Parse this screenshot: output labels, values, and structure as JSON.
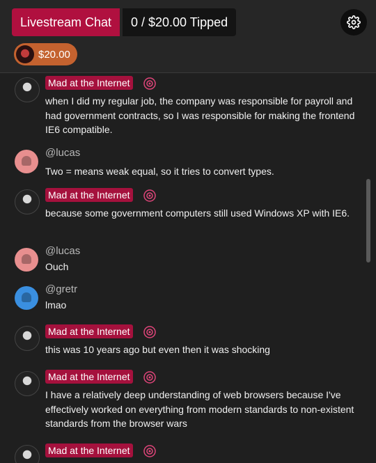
{
  "header": {
    "title": "Livestream Chat",
    "tipped": "0 / $20.00 Tipped",
    "tip_chip": "$20.00",
    "settings_icon": "gear-icon"
  },
  "colors": {
    "accent": "#b0103f",
    "username_badge": "#a5113d",
    "tip_chip": "#c4622f",
    "lucas_avatar": "#e88f8f",
    "gretr_avatar": "#3a8fe0"
  },
  "messages": [
    {
      "user": "Mad at the Internet",
      "text": "when I did my regular job, the company was responsible for payroll and had government contracts, so I was responsible for making the frontend IE6 compatible."
    },
    {
      "user": "@lucas",
      "text": "Two = means weak equal, so it tries to convert types."
    },
    {
      "user": "Mad at the Internet",
      "text": "because some government computers still used Windows XP with IE6."
    },
    {
      "user": "@lucas",
      "text": "Ouch"
    },
    {
      "user": "@gretr",
      "text": "lmao"
    },
    {
      "user": "Mad at the Internet",
      "text": "this was 10 years ago but even then it was shocking"
    },
    {
      "user": "Mad at the Internet",
      "text": "I have a relatively deep understanding of web browsers because I've effectively worked on everything from modern standards to non-existent standards from the browser wars"
    },
    {
      "user": "Mad at the Internet",
      "text": ""
    }
  ]
}
